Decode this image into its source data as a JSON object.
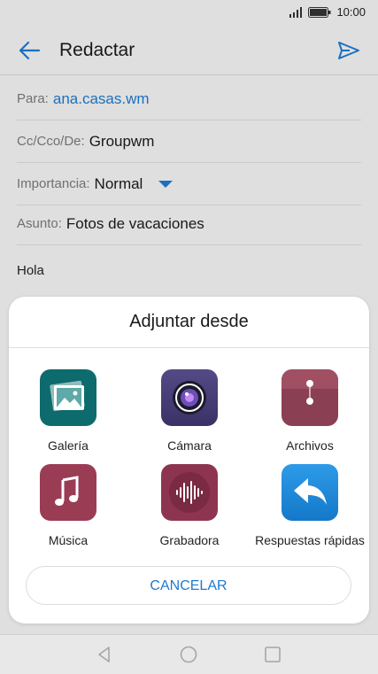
{
  "status_bar": {
    "time": "10:00"
  },
  "app_bar": {
    "title": "Redactar"
  },
  "compose": {
    "to_label": "Para:",
    "to_value": "ana.casas.wm",
    "cc_label": "Cc/Cco/De:",
    "cc_value": "Groupwm",
    "importance_label": "Importancia:",
    "importance_value": "Normal",
    "subject_label": "Asunto:",
    "subject_value": "Fotos de vacaciones",
    "body": "Hola"
  },
  "attach_sheet": {
    "title": "Adjuntar desde",
    "items": [
      {
        "label": "Galería",
        "icon": "gallery-icon"
      },
      {
        "label": "Cámara",
        "icon": "camera-icon"
      },
      {
        "label": "Archivos",
        "icon": "files-icon"
      },
      {
        "label": "Música",
        "icon": "music-icon"
      },
      {
        "label": "Grabadora",
        "icon": "recorder-icon"
      },
      {
        "label": "Respuestas rápidas",
        "icon": "quick-reply-icon"
      }
    ],
    "cancel_label": "CANCELAR"
  },
  "colors": {
    "accent": "#1e7ad0"
  }
}
